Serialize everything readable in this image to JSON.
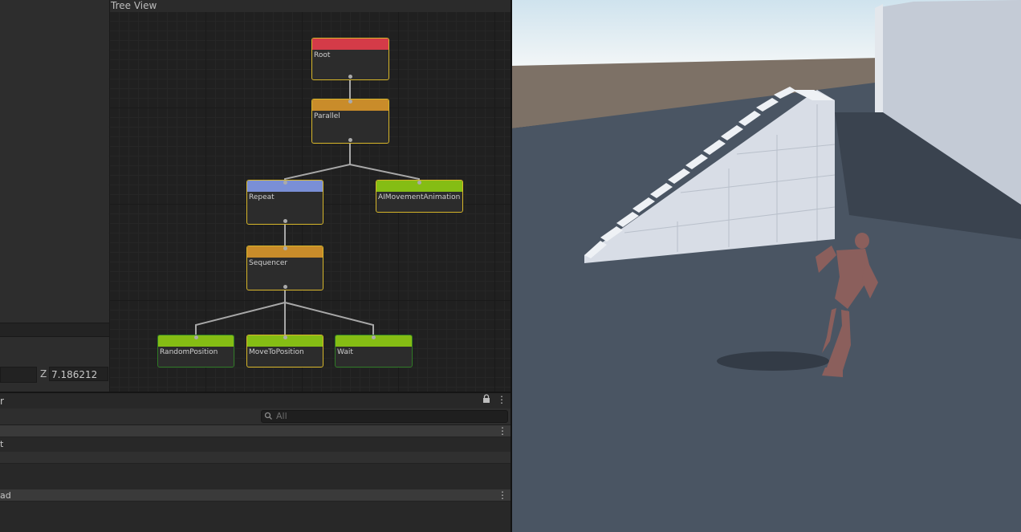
{
  "tree_view": {
    "title": "Tree View",
    "nodes": [
      {
        "id": "root",
        "label": "Root",
        "color": "#d43b48"
      },
      {
        "id": "parallel",
        "label": "Parallel",
        "color": "#c98c2a"
      },
      {
        "id": "repeat",
        "label": "Repeat",
        "color": "#7a8fd6"
      },
      {
        "id": "ai-movement",
        "label": "AIMovementAnimation",
        "color": "#85bd14"
      },
      {
        "id": "sequencer",
        "label": "Sequencer",
        "color": "#c98c2a"
      },
      {
        "id": "random-position",
        "label": "RandomPosition",
        "color": "#85bd14"
      },
      {
        "id": "move-to-position",
        "label": "MoveToPosition",
        "color": "#85bd14"
      },
      {
        "id": "wait",
        "label": "Wait",
        "color": "#85bd14"
      }
    ]
  },
  "inspector": {
    "z_label": "Z",
    "z_value": "7.186212"
  },
  "bottom_panel": {
    "title_fragment": "r",
    "search_placeholder": "All",
    "row1_label": "t",
    "row2_label": "ad"
  },
  "colors": {
    "selected_border": "#d7b62a",
    "ground": "#4a5563"
  }
}
